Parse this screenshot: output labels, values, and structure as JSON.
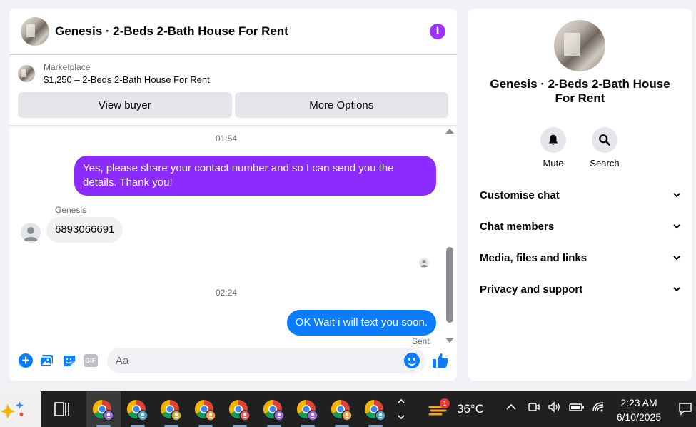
{
  "chat": {
    "title": "Genesis · 2-Beds 2-Bath House For Rent",
    "marketplace_label": "Marketplace",
    "listing": "$1,250 – 2-Beds 2-Bath House For Rent",
    "view_buyer": "View buyer",
    "more_options": "More Options",
    "messages": {
      "ts1": "01:54",
      "out1": "Yes, please share your contact number and so I can send you the details. Thank you!",
      "sender": "Genesis",
      "in1": "6893066691",
      "ts2": "02:24",
      "out2": "OK Wait i will text you soon.",
      "status": "Sent"
    },
    "composer_placeholder": "Aa"
  },
  "info": {
    "name": "Genesis · 2-Beds 2-Bath House For Rent",
    "mute": "Mute",
    "search": "Search",
    "sections": [
      "Customise chat",
      "Chat members",
      "Media, files and links",
      "Privacy and support"
    ]
  },
  "taskbar": {
    "weather_badge": "1",
    "temperature": "36°C",
    "time": "2:23 AM",
    "date": "6/10/2025"
  },
  "colors": {
    "accent_purple": "#a033ff",
    "bubble_purple": "#8b2bff",
    "bubble_blue": "#0a7cff"
  }
}
